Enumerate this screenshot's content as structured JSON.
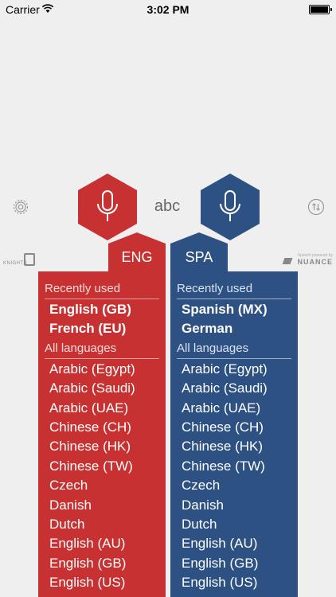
{
  "status_bar": {
    "carrier": "Carrier",
    "time": "3:02 PM"
  },
  "icons": {
    "settings": "gear-icon",
    "swap": "swap-arrows-icon",
    "mic": "microphone-icon",
    "wifi": "wifi-icon",
    "battery": "battery-icon"
  },
  "center": {
    "abc_label": "abc"
  },
  "logos": {
    "left": "KNIGHTS",
    "right_small": "Speech powered by",
    "right_brand": "NUANCE"
  },
  "colors": {
    "source": "#c73131",
    "target": "#2d5183",
    "background": "#efefef"
  },
  "source": {
    "code": "ENG",
    "recent_label": "Recently used",
    "recent": [
      "English (GB)",
      "French (EU)"
    ],
    "all_label": "All languages",
    "all": [
      "Arabic (Egypt)",
      "Arabic (Saudi)",
      "Arabic (UAE)",
      "Chinese (CH)",
      "Chinese (HK)",
      "Chinese (TW)",
      "Czech",
      "Danish",
      "Dutch",
      "English (AU)",
      "English (GB)",
      "English (US)"
    ]
  },
  "target": {
    "code": "SPA",
    "recent_label": "Recently used",
    "recent": [
      "Spanish (MX)",
      "German"
    ],
    "all_label": "All languages",
    "all": [
      "Arabic (Egypt)",
      "Arabic (Saudi)",
      "Arabic (UAE)",
      "Chinese (CH)",
      "Chinese (HK)",
      "Chinese (TW)",
      "Czech",
      "Danish",
      "Dutch",
      "English (AU)",
      "English (GB)",
      "English (US)"
    ]
  }
}
